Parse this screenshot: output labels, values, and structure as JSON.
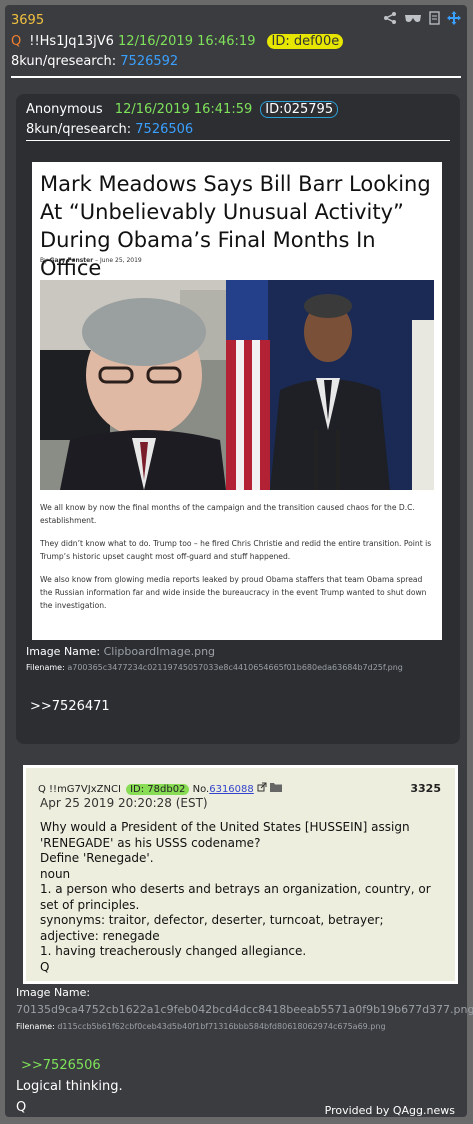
{
  "post": {
    "number": "3695",
    "q_mark": "Q",
    "tripcode": "!!Hs1Jq13jV6",
    "datetime": "12/16/2019 16:46:19",
    "id": "ID: def00e",
    "board": "8kun/qresearch:",
    "post_link": "7526592"
  },
  "quoted": {
    "author": "Anonymous",
    "datetime": "12/16/2019 16:41:59",
    "id": "ID:025795",
    "board": "8kun/qresearch:",
    "post_link": "7526506",
    "article": {
      "title": "Mark Meadows Says Bill Barr Looking At “Unbelievably Unusual Activity” During Obama’s Final Months In Office",
      "byline_prefix": "By",
      "byline_author": "Gary Fenster",
      "byline_date": "– June 25, 2019",
      "paragraphs": [
        "We all know by now the final months of the campaign and the transition caused chaos for the D.C. establishment.",
        "They didn’t know what to do. Trump too – he fired Chris Christie and redid the entire transition. Point is Trump’s historic upset caught most off-guard and stuff happened.",
        "We also know from glowing media reports leaked by proud Obama staffers that team Obama spread the Russian information far and wide inside the bureaucracy in the event Trump wanted to shut down the investigation."
      ]
    },
    "image_name_label": "Image Name:",
    "image_name": "ClipboardImage.png",
    "filename_label": "Filename:",
    "filename": "a700365c3477234c02119745057033e8c4410654665f01b680eda63684b7d25f.png",
    "reply": ">>7526471"
  },
  "screenshot": {
    "head_q": "Q !!mG7VJxZNCI",
    "id": "ID: 78db02",
    "no_label": "No.",
    "no": "6316088",
    "number": "3325",
    "date": "Apr 25 2019 20:20:28 (EST)",
    "lines": [
      "Why would a President of the United States [HUSSEIN] assign 'RENEGADE' as his USSS codename?",
      "Define 'Renegade'.",
      "noun",
      "1. a person who deserts and betrays an organization, country, or set of principles.",
      "synonyms: traitor, defector, deserter, turncoat, betrayer;",
      "adjective: renegade",
      "1. having treacherously changed allegiance.",
      "Q"
    ]
  },
  "bottom": {
    "image_name_label": "Image Name:",
    "image_name": "70135d9ca4752cb1622a1c9feb042bcd4dcc8418beeab5571a0f9b19b677d377.png",
    "filename_label": "Filename:",
    "filename": "d115ccb5b61f62cbf0ceb43d5b40f1bf71316bbb584bfd80618062974c675a69.png",
    "reply": ">>7526506",
    "text1": "Logical thinking.",
    "text2": "Q",
    "credit": "Provided by QAgg.news"
  },
  "icons": [
    "share-icon",
    "glasses-icon",
    "document-icon",
    "move-icon"
  ],
  "colors": {
    "background": "#6a6a6a",
    "card": "#3b3c3f",
    "quote_box": "#2c2e32",
    "post_number": "#f0c040",
    "green": "#7ee25a",
    "link": "#3aa0ff",
    "id_highlight": "#e6e600"
  }
}
